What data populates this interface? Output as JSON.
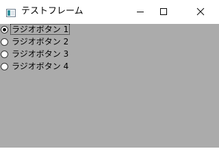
{
  "window": {
    "title": "テストフレーム",
    "icon": "java-app-icon",
    "controls": {
      "minimize_icon": "minimize-icon",
      "maximize_icon": "maximize-icon",
      "close_icon": "close-icon"
    }
  },
  "radio_group": {
    "items": [
      {
        "label": "ラジオボタン 1",
        "checked": true,
        "focused": true
      },
      {
        "label": "ラジオボタン 2",
        "checked": false,
        "focused": false
      },
      {
        "label": "ラジオボタン 3",
        "checked": false,
        "focused": false
      },
      {
        "label": "ラジオボタン 4",
        "checked": false,
        "focused": false
      }
    ]
  },
  "colors": {
    "client_background": "#ababab",
    "titlebar_background": "#ffffff",
    "text": "#000000"
  }
}
